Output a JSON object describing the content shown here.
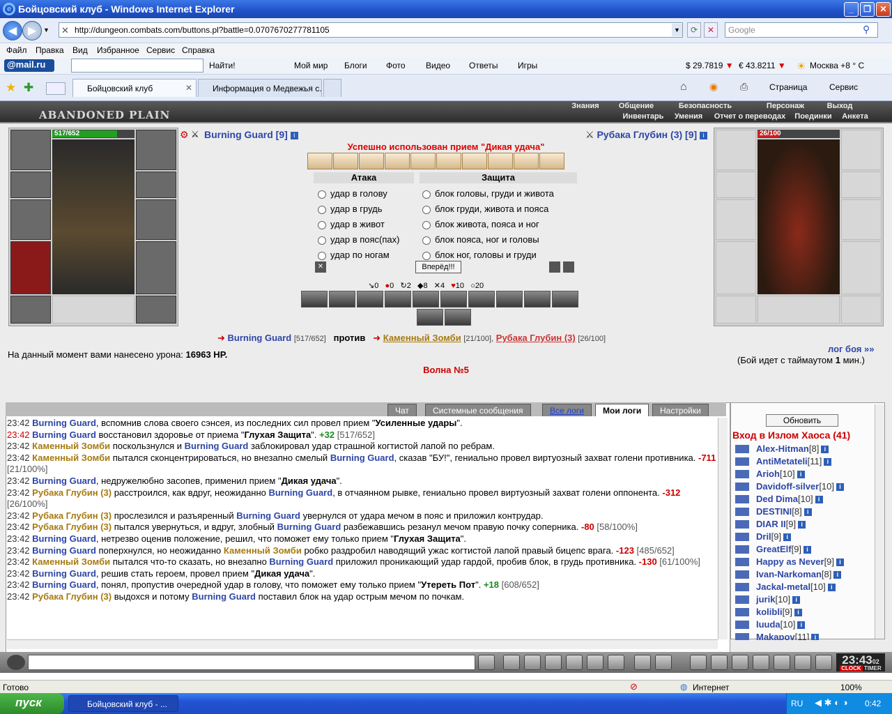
{
  "window": {
    "title": "Бойцовский клуб - Windows Internet Explorer"
  },
  "address": {
    "url": "http://dungeon.combats.com/buttons.pl?battle=0.0707670277781105",
    "search_placeholder": "Google"
  },
  "menu": [
    "Файл",
    "Правка",
    "Вид",
    "Избранное",
    "Сервис",
    "Справка"
  ],
  "toolbar": {
    "logo": "@mail.ru",
    "find": "Найти!",
    "links": [
      "Мой мир",
      "Блоги",
      "Фото",
      "Видео",
      "Ответы",
      "Игры"
    ],
    "usd": "$ 29.7819",
    "eur": "€ 43.8211",
    "weather": "Москва +8 ° C"
  },
  "tabs": [
    "Бойцовский клуб",
    "Информация о Медвежья с..."
  ],
  "iecmd": {
    "page": "Страница",
    "service": "Сервис"
  },
  "game": {
    "logo": "ABANDONED PLAIN",
    "nav1": [
      "Знания",
      "Общение",
      "Безопасность",
      "Персонаж",
      "Выход"
    ],
    "nav2": [
      "Инвентарь",
      "Умения",
      "Отчет о переводах",
      "Поединки",
      "Анкета"
    ],
    "player": {
      "name": "Burning Guard",
      "level": "[9]",
      "hp": "517/652",
      "hp_frac": 0.79
    },
    "enemy": {
      "name": "Рубака Глубин (3)",
      "level": "[9]",
      "hp": "26/100",
      "hp_frac": 0.26
    },
    "status_msg": "Успешно использован прием \"Дикая удача\"",
    "attack_title": "Атака",
    "defense_title": "Защита",
    "attacks": [
      "удар в голову",
      "удар в грудь",
      "удар в живот",
      "удар в пояс(пах)",
      "удар по ногам"
    ],
    "defenses": [
      "блок головы, груди и живота",
      "блок груди, живота и пояса",
      "блок живота, пояса и ног",
      "блок пояса, ног и головы",
      "блок ног, головы и груди"
    ],
    "go_button": "Вперёд!!!",
    "counters": [
      "0",
      "0",
      "2",
      "8",
      "4",
      "10",
      "20"
    ],
    "versus": {
      "p1": "Burning Guard",
      "p1hp": "[517/652]",
      "vs": "против",
      "e1": "Каменный Зомби",
      "e1hp": "[21/100],",
      "e2": "Рубака Глубин (3)",
      "e2hp": "[26/100]"
    },
    "damage_label": "На данный момент вами нанесено урона:",
    "damage_value": "16963 HP.",
    "wave": "Волна №5",
    "log_link": "лог боя »»",
    "timeout_pre": "(Бой идет с таймаутом",
    "timeout_val": "1",
    "timeout_post": "мин.)"
  },
  "logtabs": [
    "Чат",
    "Системные сообщения",
    "Все логи",
    "Мои логи",
    "Настройки"
  ],
  "log": [
    {
      "t": "23:42",
      "parts": [
        [
          "n",
          "Burning Guard"
        ],
        [
          "x",
          ", вспомнив слова своего сэнсея, из последних сил провел прием \""
        ],
        [
          "b",
          "Усиленные удары"
        ],
        [
          "x",
          "\"."
        ]
      ]
    },
    {
      "t": "23:42",
      "red": true,
      "parts": [
        [
          "n",
          "Burning Guard"
        ],
        [
          "x",
          " восстановил здоровье от приема \""
        ],
        [
          "b",
          "Глухая Защита"
        ],
        [
          "x",
          "\". "
        ],
        [
          "h",
          "+32"
        ],
        [
          "v",
          " [517/652]"
        ]
      ]
    },
    {
      "t": "23:42",
      "parts": [
        [
          "z",
          "Каменный Зомби"
        ],
        [
          "x",
          " поскользнулся и "
        ],
        [
          "n",
          "Burning Guard"
        ],
        [
          "x",
          " заблокировал удар страшной когтистой лапой по ребрам."
        ]
      ]
    },
    {
      "t": "23:42",
      "parts": [
        [
          "z",
          "Каменный Зомби"
        ],
        [
          "x",
          " пытался сконцентрироваться, но внезапно смелый "
        ],
        [
          "n",
          "Burning Guard"
        ],
        [
          "x",
          ", сказав \"БУ!\", гениально провел виртуозный захват голени противника. "
        ],
        [
          "d",
          "-711"
        ],
        [
          "v",
          " [21/100%]"
        ]
      ]
    },
    {
      "t": "23:42",
      "parts": [
        [
          "n",
          "Burning Guard"
        ],
        [
          "x",
          ", недружелюбно засопев, применил прием \""
        ],
        [
          "b",
          "Дикая удача"
        ],
        [
          "x",
          "\"."
        ]
      ]
    },
    {
      "t": "23:42",
      "parts": [
        [
          "z",
          "Рубака Глубин (3)"
        ],
        [
          "x",
          " расстроился, как вдруг, неожиданно "
        ],
        [
          "n",
          "Burning Guard"
        ],
        [
          "x",
          ", в отчаянном рывке, гениально провел виртуозный захват голени оппонента. "
        ],
        [
          "d",
          "-312"
        ],
        [
          "v",
          " [26/100%]"
        ]
      ]
    },
    {
      "t": "23:42",
      "parts": [
        [
          "z",
          "Рубака Глубин (3)"
        ],
        [
          "x",
          " прослезился и разъяренный "
        ],
        [
          "n",
          "Burning Guard"
        ],
        [
          "x",
          " увернулся от удара мечом в пояс и приложил контрудар."
        ]
      ]
    },
    {
      "t": "23:42",
      "parts": [
        [
          "z",
          "Рубака Глубин (3)"
        ],
        [
          "x",
          " пытался увернуться, и вдруг, злобный "
        ],
        [
          "n",
          "Burning Guard"
        ],
        [
          "x",
          " разбежавшись резанул мечом правую почку соперника. "
        ],
        [
          "d",
          "-80"
        ],
        [
          "v",
          " [58/100%]"
        ]
      ]
    },
    {
      "t": "23:42",
      "parts": [
        [
          "n",
          "Burning Guard"
        ],
        [
          "x",
          ", нетрезво оценив положение, решил, что поможет ему только прием \""
        ],
        [
          "b",
          "Глухая Защита"
        ],
        [
          "x",
          "\"."
        ]
      ]
    },
    {
      "t": "23:42",
      "parts": [
        [
          "n",
          "Burning Guard"
        ],
        [
          "x",
          " поперхнулся, но неожиданно "
        ],
        [
          "z",
          "Каменный Зомби"
        ],
        [
          "x",
          " робко раздробил наводящий ужас когтистой лапой правый бицепс врага. "
        ],
        [
          "d",
          "-123"
        ],
        [
          "v",
          " [485/652]"
        ]
      ]
    },
    {
      "t": "23:42",
      "parts": [
        [
          "z",
          "Каменный Зомби"
        ],
        [
          "x",
          " пытался что-то сказать, но внезапно "
        ],
        [
          "n",
          "Burning Guard"
        ],
        [
          "x",
          " приложил проникающий удар гардой, пробив блок, в грудь противника. "
        ],
        [
          "d",
          "-130"
        ],
        [
          "v",
          " [61/100%]"
        ]
      ]
    },
    {
      "t": "23:42",
      "parts": [
        [
          "n",
          "Burning Guard"
        ],
        [
          "x",
          ", решив стать героем, провел прием \""
        ],
        [
          "b",
          "Дикая удача"
        ],
        [
          "x",
          "\"."
        ]
      ]
    },
    {
      "t": "23:42",
      "parts": [
        [
          "n",
          "Burning Guard"
        ],
        [
          "x",
          ", понял, пропустив очередной удар в голову, что поможет ему только прием \""
        ],
        [
          "b",
          "Утереть Пот"
        ],
        [
          "x",
          "\". "
        ],
        [
          "h",
          "+18"
        ],
        [
          "v",
          " [608/652]"
        ]
      ]
    },
    {
      "t": "23:42",
      "parts": [
        [
          "z",
          "Рубака Глубин (3)"
        ],
        [
          "x",
          " выдохся и потому "
        ],
        [
          "n",
          "Burning Guard"
        ],
        [
          "x",
          " поставил блок на удар острым мечом по почкам."
        ]
      ]
    }
  ],
  "right": {
    "refresh": "Обновить",
    "title": "Вход в Излом Хаоса (41)",
    "users": [
      [
        "Alex-Hitman",
        "[8]"
      ],
      [
        "AntiMetateli",
        "[11]"
      ],
      [
        "Arioh",
        "[10]"
      ],
      [
        "Davidoff-silver",
        "[10]"
      ],
      [
        "Ded Dima",
        "[10]"
      ],
      [
        "DESTINI",
        "[8]"
      ],
      [
        "DIAR II",
        "[9]"
      ],
      [
        "Dril",
        "[9]"
      ],
      [
        "GreatElf",
        "[9]"
      ],
      [
        "Happy as Never",
        "[9]"
      ],
      [
        "Ivan-Narkoman",
        "[8]"
      ],
      [
        "Jackal-metal",
        "[10]"
      ],
      [
        "jurik",
        "[10]"
      ],
      [
        "kolibli",
        "[9]"
      ],
      [
        "luuda",
        "[10]"
      ],
      [
        "Makapov",
        "[11]"
      ]
    ]
  },
  "clock": {
    "time": "23:43",
    "sec": "02",
    "c1": "CLOCK",
    "c2": "TIMER"
  },
  "status": {
    "left": "Готово",
    "zone": "Интернет",
    "zoom": "100%"
  },
  "taskbar": {
    "start": "пуск",
    "task": "Бойцовский клуб - ...",
    "lang": "RU",
    "time": "0:42"
  }
}
